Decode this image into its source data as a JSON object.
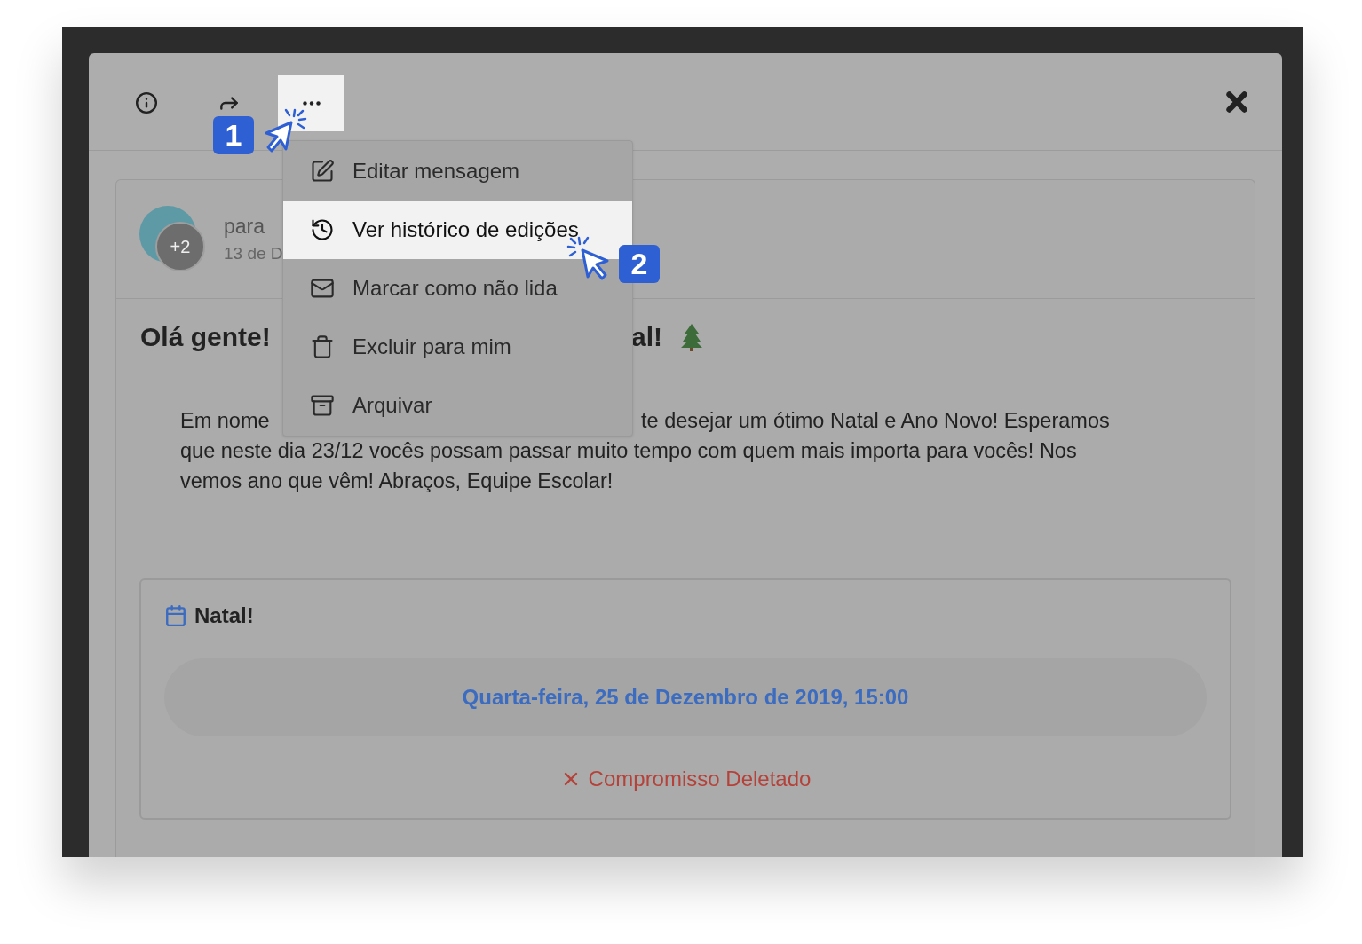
{
  "toolbar": {
    "buttons": [
      {
        "kind": "info",
        "selected": false
      },
      {
        "kind": "share",
        "selected": false
      },
      {
        "kind": "more",
        "selected": true
      }
    ],
    "close": {
      "kind": "close"
    }
  },
  "menu": {
    "items": [
      {
        "kind": "edit",
        "label": "Editar mensagem",
        "selected": false
      },
      {
        "kind": "history",
        "label": "Ver histórico de edições",
        "selected": true
      },
      {
        "kind": "mail",
        "label": "Marcar como não lida",
        "selected": false
      },
      {
        "kind": "trash",
        "label": "Excluir para mim",
        "selected": false
      },
      {
        "kind": "archive",
        "label": "Arquivar",
        "selected": false
      }
    ]
  },
  "callouts": [
    {
      "label": "1"
    },
    {
      "label": "2"
    }
  ],
  "message": {
    "avatar_badge": "+2",
    "recipient_prefix": "para",
    "date": "13 de D",
    "title_parts": [
      "Olá gente!",
      "al!"
    ],
    "body_first_line": [
      "Em nome",
      "te desejar um ótimo Natal e Ano Novo! Esperamos"
    ],
    "body_lines": [
      "que neste dia 23/12 vocês possam passar muito tempo com quem mais importa para vocês! Nos",
      "vemos ano que vêm! Abraços, Equipe Escolar!"
    ],
    "event": {
      "title": "Natal!",
      "date": "Quarta-feira, 25 de Dezembro de 2019, 15:00",
      "status": {
        "kind": "deleted",
        "label": "Compromisso Deletado"
      }
    }
  }
}
